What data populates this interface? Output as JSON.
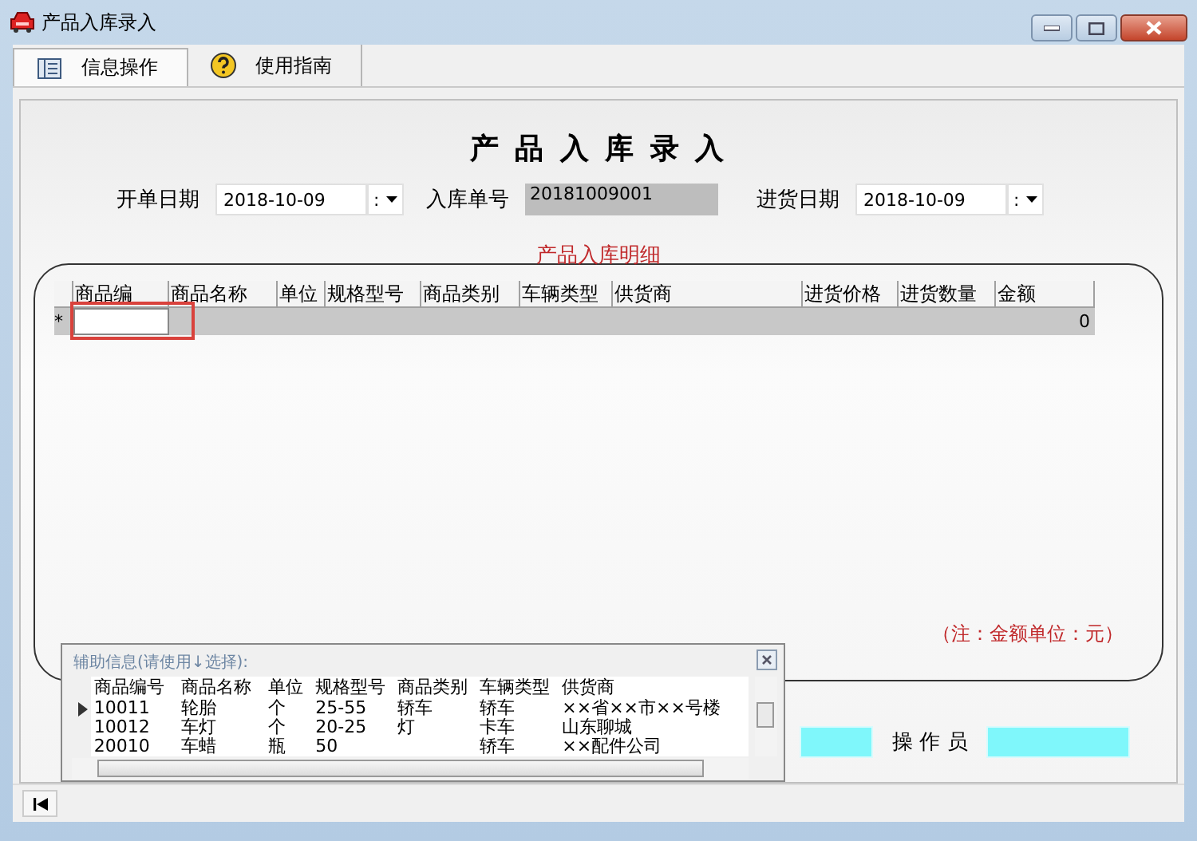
{
  "window": {
    "title": "产品入库录入"
  },
  "tabs": [
    {
      "label": "信息操作",
      "selected": true
    },
    {
      "label": "使用指南",
      "selected": false
    }
  ],
  "form": {
    "heading": "产 品 入 库 录 入",
    "fields": [
      {
        "label": "开单日期",
        "value": "2018-10-09",
        "kind": "date",
        "dropdown": ":"
      },
      {
        "label": "入库单号",
        "value": "20181009001",
        "kind": "readonly"
      },
      {
        "label": "进货日期",
        "value": "2018-10-09",
        "kind": "date",
        "dropdown": ":"
      }
    ]
  },
  "detail": {
    "title": "产品入库明细",
    "columns": [
      "商品编",
      "商品名称",
      "单位",
      "规格型号",
      "商品类别",
      "车辆类型",
      "供货商",
      "进货价格",
      "进货数量",
      "金额"
    ],
    "new_row": {
      "marker": "*",
      "amount": "0"
    },
    "note": "（注：金额单位：元）"
  },
  "footer": {
    "operator_label": "操 作 员"
  },
  "lookup": {
    "title": "辅助信息(请使用↓选择):",
    "columns": [
      "商品编号",
      "商品名称",
      "单位",
      "规格型号",
      "商品类别",
      "车辆类型",
      "供货商"
    ],
    "rows": [
      {
        "selected": true,
        "cells": [
          "10011",
          "轮胎",
          "个",
          "25-55",
          "轿车",
          "轿车",
          "××省××市××号楼"
        ]
      },
      {
        "selected": false,
        "cells": [
          "10012",
          "车灯",
          "个",
          "20-25",
          "灯",
          "卡车",
          "山东聊城"
        ]
      },
      {
        "selected": false,
        "cells": [
          "20010",
          "车蜡",
          "瓶",
          "50",
          "",
          "轿车",
          "××配件公司"
        ]
      }
    ]
  }
}
